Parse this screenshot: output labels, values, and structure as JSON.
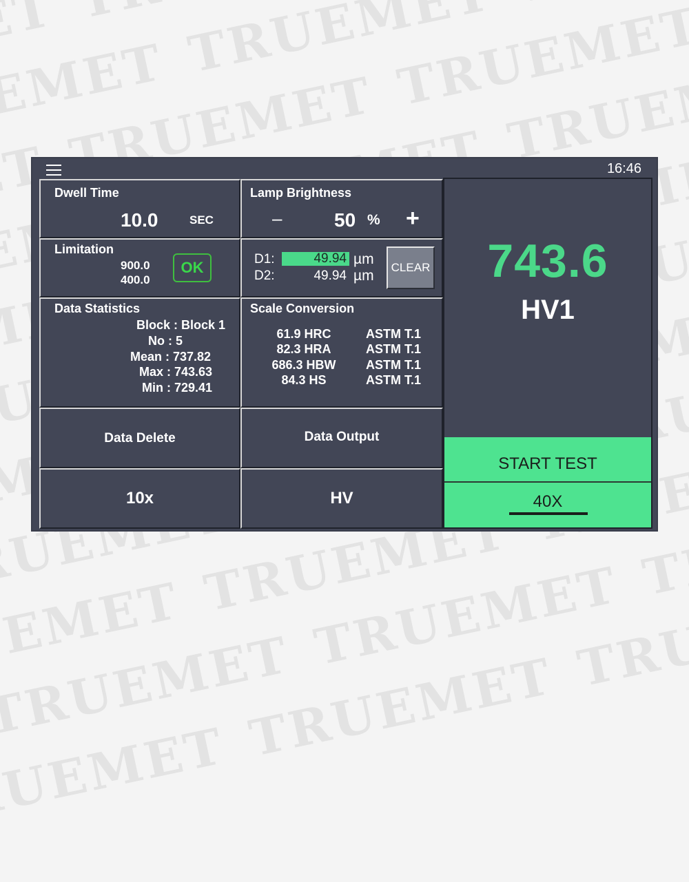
{
  "watermark": {
    "text": "TRUEMET",
    "color": "#e3e3e3"
  },
  "topbar": {
    "menu_icon": "hamburger-menu-icon",
    "time": "16:46"
  },
  "dwell": {
    "title": "Dwell Time",
    "value": "10.0",
    "unit": "SEC"
  },
  "lamp": {
    "title": "Lamp Brightness",
    "minus": "–",
    "value": "50",
    "unit": "%",
    "plus": "+"
  },
  "limitation": {
    "title": "Limitation",
    "upper": "900.0",
    "lower": "400.0",
    "ok_label": "OK"
  },
  "measure": {
    "d1_label": "D1:",
    "d1_value": "49.94",
    "d1_unit": "µm",
    "d2_label": "D2:",
    "d2_value": "49.94",
    "d2_unit": "µm",
    "clear_label": "CLEAR"
  },
  "stats": {
    "title": "Data Statistics",
    "block": "Block : Block 1",
    "no": "No : 5",
    "mean": "Mean : 737.82",
    "max": "Max : 743.63",
    "min": "Min : 729.41"
  },
  "scale": {
    "title": "Scale Conversion",
    "rows": [
      {
        "value": "61.9 HRC",
        "std": "ASTM T.1"
      },
      {
        "value": "82.3 HRA",
        "std": "ASTM T.1"
      },
      {
        "value": "686.3 HBW",
        "std": "ASTM T.1"
      },
      {
        "value": "84.3 HS",
        "std": "ASTM T.1"
      }
    ]
  },
  "buttons": {
    "data_delete": "Data Delete",
    "data_output": "Data Output",
    "objective": "10x",
    "scale_mode": "HV"
  },
  "result": {
    "value": "743.6",
    "unit": "HV1",
    "start_label": "START TEST",
    "magnification": "40X"
  },
  "colors": {
    "panel_bg": "#424656",
    "accent_green": "#4ee390",
    "value_green": "#4bd889",
    "ok_green": "#3ad74a"
  }
}
